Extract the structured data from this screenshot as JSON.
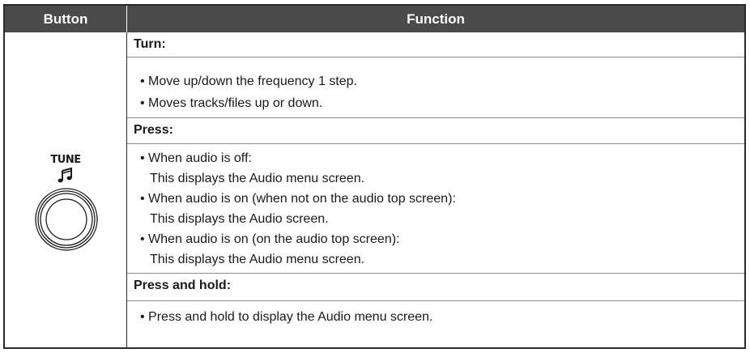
{
  "header": {
    "button_label": "Button",
    "function_label": "Function"
  },
  "button_cell": {
    "label": "TUNE",
    "icons": [
      "music-note-icon",
      "tune-knob-icon"
    ]
  },
  "sections": [
    {
      "heading": "Turn:",
      "items": [
        {
          "text": "• Move up/down the frequency 1 step."
        },
        {
          "text": "• Moves tracks/files up or down."
        }
      ]
    },
    {
      "heading": "Press:",
      "items": [
        {
          "text": "• When audio is off:",
          "detail": "This displays the Audio menu screen."
        },
        {
          "text": "• When audio is on (when not on the audio top screen):",
          "detail": "This displays the Audio screen."
        },
        {
          "text": "• When audio is on (on the audio top screen):",
          "detail": "This displays the Audio menu screen."
        }
      ]
    },
    {
      "heading": "Press and hold:",
      "items": [
        {
          "text": "• Press and hold to display the Audio menu screen."
        }
      ]
    }
  ],
  "colors": {
    "header_bg": "#4a4a4a",
    "header_text": "#ffffff",
    "border": "#2a2a2a",
    "rule": "#8a8a8a"
  }
}
